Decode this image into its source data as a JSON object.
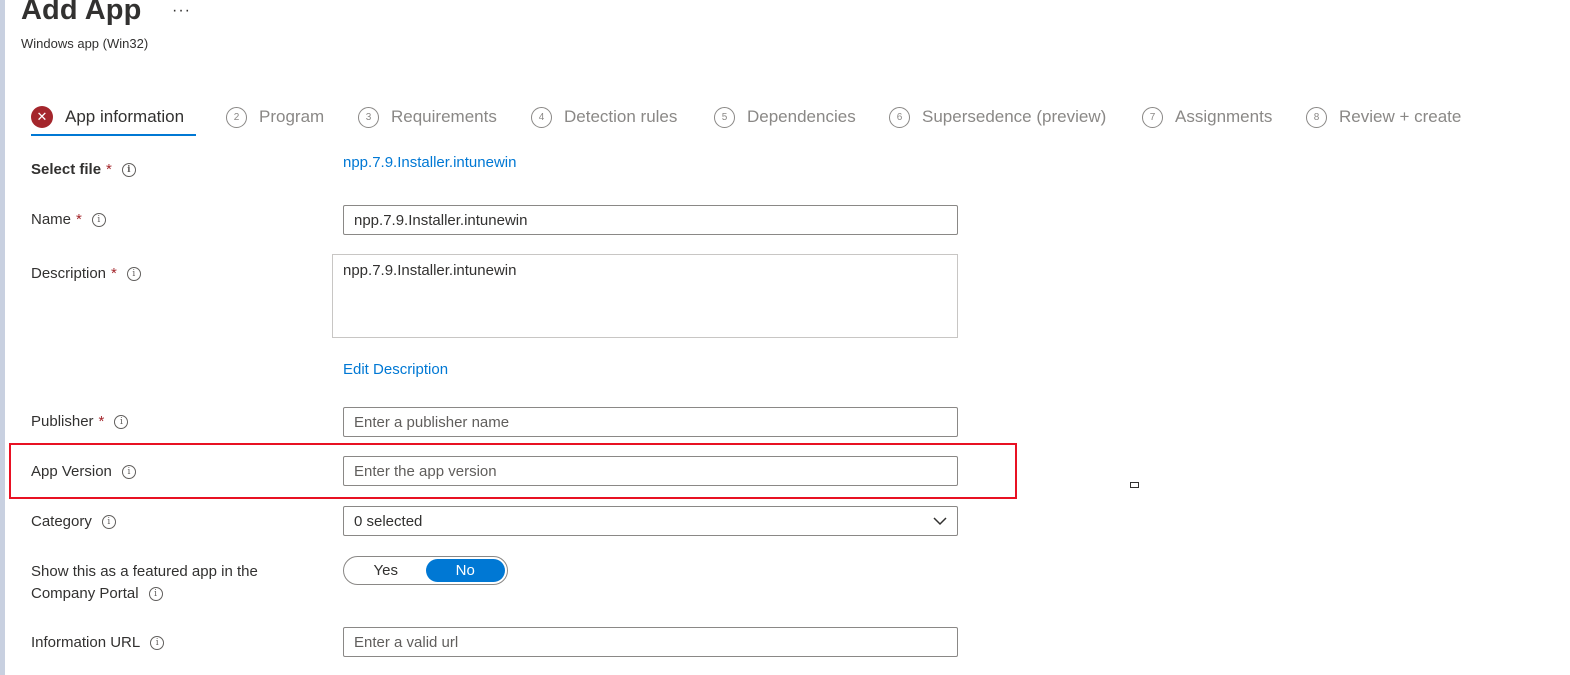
{
  "header": {
    "title": "Add App",
    "more_label": "···",
    "subtitle": "Windows app (Win32)"
  },
  "tabs": [
    {
      "num": "",
      "label": "App information",
      "status": "error"
    },
    {
      "num": "2",
      "label": "Program"
    },
    {
      "num": "3",
      "label": "Requirements"
    },
    {
      "num": "4",
      "label": "Detection rules"
    },
    {
      "num": "5",
      "label": "Dependencies"
    },
    {
      "num": "6",
      "label": "Supersedence (preview)"
    },
    {
      "num": "7",
      "label": "Assignments"
    },
    {
      "num": "8",
      "label": "Review + create"
    }
  ],
  "form": {
    "required_mark": "*",
    "info_glyph": "i",
    "select_file": {
      "label": "Select file",
      "value": "npp.7.9.Installer.intunewin"
    },
    "name": {
      "label": "Name",
      "value": "npp.7.9.Installer.intunewin"
    },
    "description": {
      "label": "Description",
      "value": "npp.7.9.Installer.intunewin",
      "edit_link": "Edit Description"
    },
    "publisher": {
      "label": "Publisher",
      "placeholder": "Enter a publisher name"
    },
    "app_version": {
      "label": "App Version",
      "placeholder": "Enter the app version"
    },
    "category": {
      "label": "Category",
      "value": "0 selected"
    },
    "featured": {
      "label_line1": "Show this as a featured app in the",
      "label_line2": "Company Portal",
      "yes": "Yes",
      "no": "No",
      "selected": "No"
    },
    "info_url": {
      "label": "Information URL",
      "placeholder": "Enter a valid url"
    }
  },
  "colors": {
    "accent": "#0078d4",
    "error": "#a4262c",
    "highlight": "#e81123"
  }
}
